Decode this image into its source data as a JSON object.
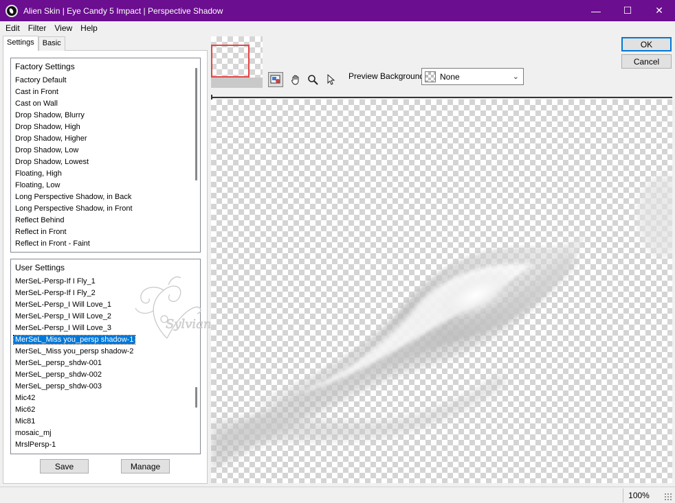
{
  "window": {
    "title": "Alien Skin | Eye Candy 5 Impact | Perspective Shadow",
    "controls": {
      "minimize": "—",
      "maximize": "☐",
      "close": "✕"
    }
  },
  "menu": [
    "Edit",
    "Filter",
    "View",
    "Help"
  ],
  "tabs": [
    "Settings",
    "Basic"
  ],
  "factory_settings": {
    "header": "Factory Settings",
    "items": [
      "Factory Default",
      "Cast in Front",
      "Cast on Wall",
      "Drop Shadow, Blurry",
      "Drop Shadow, High",
      "Drop Shadow, Higher",
      "Drop Shadow, Low",
      "Drop Shadow, Lowest",
      "Floating, High",
      "Floating, Low",
      "Long Perspective Shadow, in Back",
      "Long Perspective Shadow, in Front",
      "Reflect Behind",
      "Reflect in Front",
      "Reflect in Front - Faint"
    ]
  },
  "user_settings": {
    "header": "User Settings",
    "items": [
      "MerSeL-Persp-If I Fly_1",
      "MerSeL-Persp-If I Fly_2",
      "MerSeL-Persp_I Will Love_1",
      "MerSeL-Persp_I Will Love_2",
      "MerSeL-Persp_I Will Love_3",
      "MerSeL_Miss you_persp shadow-1",
      "MerSeL_Miss you_persp shadow-2",
      "MerSeL_persp_shdw-001",
      "MerSeL_persp_shdw-002",
      "MerSeL_persp_shdw-003",
      "Mic42",
      "Mic62",
      "Mic81",
      "mosaic_mj",
      "MrslPersp-1"
    ],
    "selected": "MerSeL_Miss you_persp shadow-1"
  },
  "buttons": {
    "save": "Save",
    "manage": "Manage",
    "ok": "OK",
    "cancel": "Cancel"
  },
  "preview_background": {
    "label": "Preview Background:",
    "value": "None"
  },
  "tools": [
    "navigator-icon",
    "hand-icon",
    "zoom-icon",
    "pointer-icon"
  ],
  "status": {
    "zoom": "100%"
  },
  "watermark": {
    "text": "Sylviane"
  },
  "colors": {
    "titlebar": "#6b0e8f",
    "selection": "#0078d7",
    "thumb_marker": "#e34545"
  }
}
